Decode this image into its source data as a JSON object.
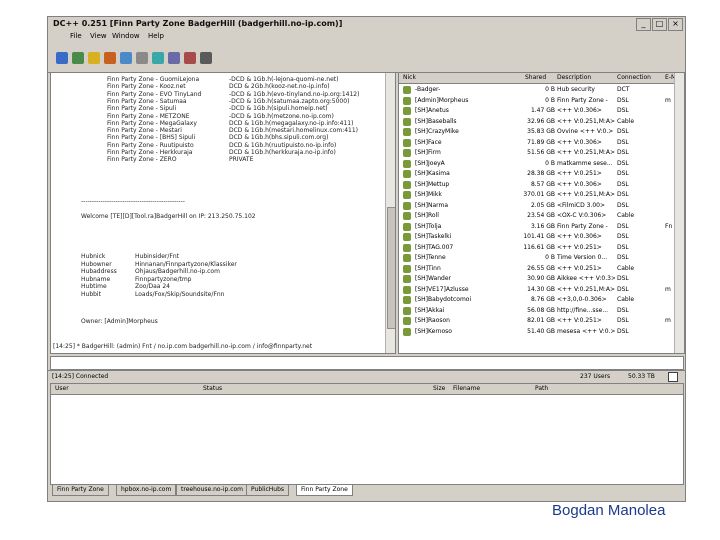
{
  "window": {
    "title": "DC++ 0.251 [Finn Party Zone BadgerHill (badgerhill.no-ip.com)]"
  },
  "menu": [
    "File",
    "View",
    "Window",
    "Help"
  ],
  "chat": {
    "hubs": [
      {
        "name": "Finn Party Zone - GuomiLejona",
        "desc": "-DCD & 1Gb.h(-lejona-quomi-ne.net)"
      },
      {
        "name": "Finn Party Zone - Kooz.net",
        "desc": "DCD & 2Gb.h(kooz-net.no-ip.info)"
      },
      {
        "name": "Finn Party Zone - EVO TinyLand",
        "desc": "-DCD & 1Gb.h(evo-tinyland.no-ip.org:1412)"
      },
      {
        "name": "Finn Party Zone - Satumaa",
        "desc": "-DCD & 1Gb.h(satumaa.zapto.org:5000)"
      },
      {
        "name": "Finn Party Zone - Sipuli",
        "desc": "-DCD & 1Gb.h(sipuli.homeip.net)"
      },
      {
        "name": "Finn Party Zone - METZONE",
        "desc": "-DCD & 1Gb.h(metzone.no-ip.com)"
      },
      {
        "name": "Finn Party Zone - MegaGalaxy",
        "desc": "DCD & 1Gb.h(megagalaxy.no-ip.info:411)"
      },
      {
        "name": "Finn Party Zone - Mestari",
        "desc": "DCD & 1Gb.h(mestari.homelinux.com:411)"
      },
      {
        "name": "Finn Party Zone - [BHS] Sipuli",
        "desc": "DCD & 1Gb.h(bhs.sipuli.com.org)"
      },
      {
        "name": "Finn Party Zone - Ruutipuisto",
        "desc": "DCD & 1Gb.h(ruutipuisto.no-ip.info)"
      },
      {
        "name": "Finn Party Zone - Herkkuraja",
        "desc": "DCD & 1Gb.h(herkkuraja.no-ip.info)"
      },
      {
        "name": "Finn Party Zone - ZERO",
        "desc": "PRIVATE"
      }
    ],
    "separator": "------------------------------------------------",
    "welcome": "Welcome [TE][D][Tool.ra]BadgerHill on IP: 213.250.75.102",
    "info": [
      {
        "label": "Hubnick",
        "value": "Hubinsider/Fnt"
      },
      {
        "label": "Hubowner",
        "value": "Hinnanan/Finnpartyzone/Klassiker"
      },
      {
        "label": "Hubaddress",
        "value": "Ohjaus/Badgerhill.no-ip.com"
      },
      {
        "label": "Hubname",
        "value": "Finnpartyzone/tmp"
      },
      {
        "label": "Hubtime",
        "value": "Zoo/Daa 24"
      },
      {
        "label": "Hubbit",
        "value": "Loads/Fox/Skip/Soundsite/Fnn"
      }
    ],
    "owner": "Owner: [Admin]Morpheus",
    "topic": "[14:25] * BadgerHill: (admin) Fnt / no.ip.com badgerhill.no-ip.com / info@finnparty.net"
  },
  "userlist": {
    "columns": [
      "Nick",
      "Shared",
      "Description",
      "Connection",
      "E-M"
    ],
    "users": [
      {
        "nick": "-Badger-",
        "shared": "0 B",
        "desc": "Hub security",
        "conn": "DCT",
        "email": ""
      },
      {
        "nick": "[Admin]Morpheus",
        "shared": "0 B",
        "desc": "Finn Party Zone -",
        "conn": "DSL",
        "email": "m"
      },
      {
        "nick": "[SH]Anetus",
        "shared": "1.47 GB",
        "desc": "<++ V:0.306>",
        "conn": "DSL",
        "email": ""
      },
      {
        "nick": "[SH]Baseballs",
        "shared": "32.96 GB",
        "desc": "<++ V:0.251,M:A>",
        "conn": "Cable",
        "email": ""
      },
      {
        "nick": "[SH]CrazyMike",
        "shared": "35.83 GB",
        "desc": "Ovvine <++ V:0.>",
        "conn": "DSL",
        "email": ""
      },
      {
        "nick": "[SH]Face",
        "shared": "71.89 GB",
        "desc": "<++ V:0.306>",
        "conn": "DSL",
        "email": ""
      },
      {
        "nick": "[SH]Firm",
        "shared": "51.56 GB",
        "desc": "<++ V:0.251,M:A>",
        "conn": "DSL",
        "email": ""
      },
      {
        "nick": "[SH]JoeyA",
        "shared": "0 B",
        "desc": "matkamme sese...",
        "conn": "DSL",
        "email": ""
      },
      {
        "nick": "[SH]Kasima",
        "shared": "28.38 GB",
        "desc": "<++ V:0.251>",
        "conn": "DSL",
        "email": ""
      },
      {
        "nick": "[SH]Mettup",
        "shared": "8.57 GB",
        "desc": "<++ V:0.306>",
        "conn": "DSL",
        "email": ""
      },
      {
        "nick": "[SH]Mikk",
        "shared": "370.01 GB",
        "desc": "<++ V:0.251,M:A>",
        "conn": "DSL",
        "email": ""
      },
      {
        "nick": "[SH]Narma",
        "shared": "2.05 GB",
        "desc": "<FilmiCD 3.00>",
        "conn": "DSL",
        "email": ""
      },
      {
        "nick": "[SH]Roll",
        "shared": "23.54 GB",
        "desc": "<OX-C V:0.306>",
        "conn": "Cable",
        "email": ""
      },
      {
        "nick": "[SH]Tolja",
        "shared": "3.16 GB",
        "desc": "Finn Party Zone -",
        "conn": "DSL",
        "email": "Fn"
      },
      {
        "nick": "[SH]Taskelki",
        "shared": "101.41 GB",
        "desc": "<++ V:0.306>",
        "conn": "DSL",
        "email": ""
      },
      {
        "nick": "[SH]TAG.007",
        "shared": "116.61 GB",
        "desc": "<++ V:0.251>",
        "conn": "DSL",
        "email": ""
      },
      {
        "nick": "[SH]Tenne",
        "shared": "0 B",
        "desc": "Time Version 0...",
        "conn": "DSL",
        "email": ""
      },
      {
        "nick": "[SH]Tinn",
        "shared": "26.55 GB",
        "desc": "<++ V:0.251>",
        "conn": "Cable",
        "email": ""
      },
      {
        "nick": "[SH]Wander",
        "shared": "30.90 GB",
        "desc": "Aikkee <++ V:0.3>",
        "conn": "DSL",
        "email": ""
      },
      {
        "nick": "[SH]VE17]Azlusse",
        "shared": "14.30 GB",
        "desc": "<++ V:0.251,M:A>",
        "conn": "DSL",
        "email": "m"
      },
      {
        "nick": "[SH]Babydotcomoi",
        "shared": "8.76 GB",
        "desc": "<+3,0,0-0.306>",
        "conn": "Cable",
        "email": ""
      },
      {
        "nick": "[SH]Akkai",
        "shared": "56.08 GB",
        "desc": "http://fine...sse...",
        "conn": "DSL",
        "email": ""
      },
      {
        "nick": "[SH]Raoson",
        "shared": "82.01 GB",
        "desc": "<++ V:0.251>",
        "conn": "DSL",
        "email": "m"
      },
      {
        "nick": "[SH]Kernoso",
        "shared": "51.40 GB",
        "desc": "mesesa <++ V:0.>",
        "conn": "DSL",
        "email": ""
      }
    ]
  },
  "statusbar": {
    "left": "[14:25] Connected",
    "users": "237 Users",
    "share": "50.33 TB"
  },
  "transfers": {
    "columns": [
      "User",
      "Status",
      "Size",
      "Filename",
      "Path"
    ]
  },
  "tabs": [
    "Finn Party Zone",
    "hpbox.no-ip.com",
    "treehouse.no-ip.com",
    "PublicHubs",
    "Finn Party Zone"
  ],
  "author": "Bogdan Manolea"
}
